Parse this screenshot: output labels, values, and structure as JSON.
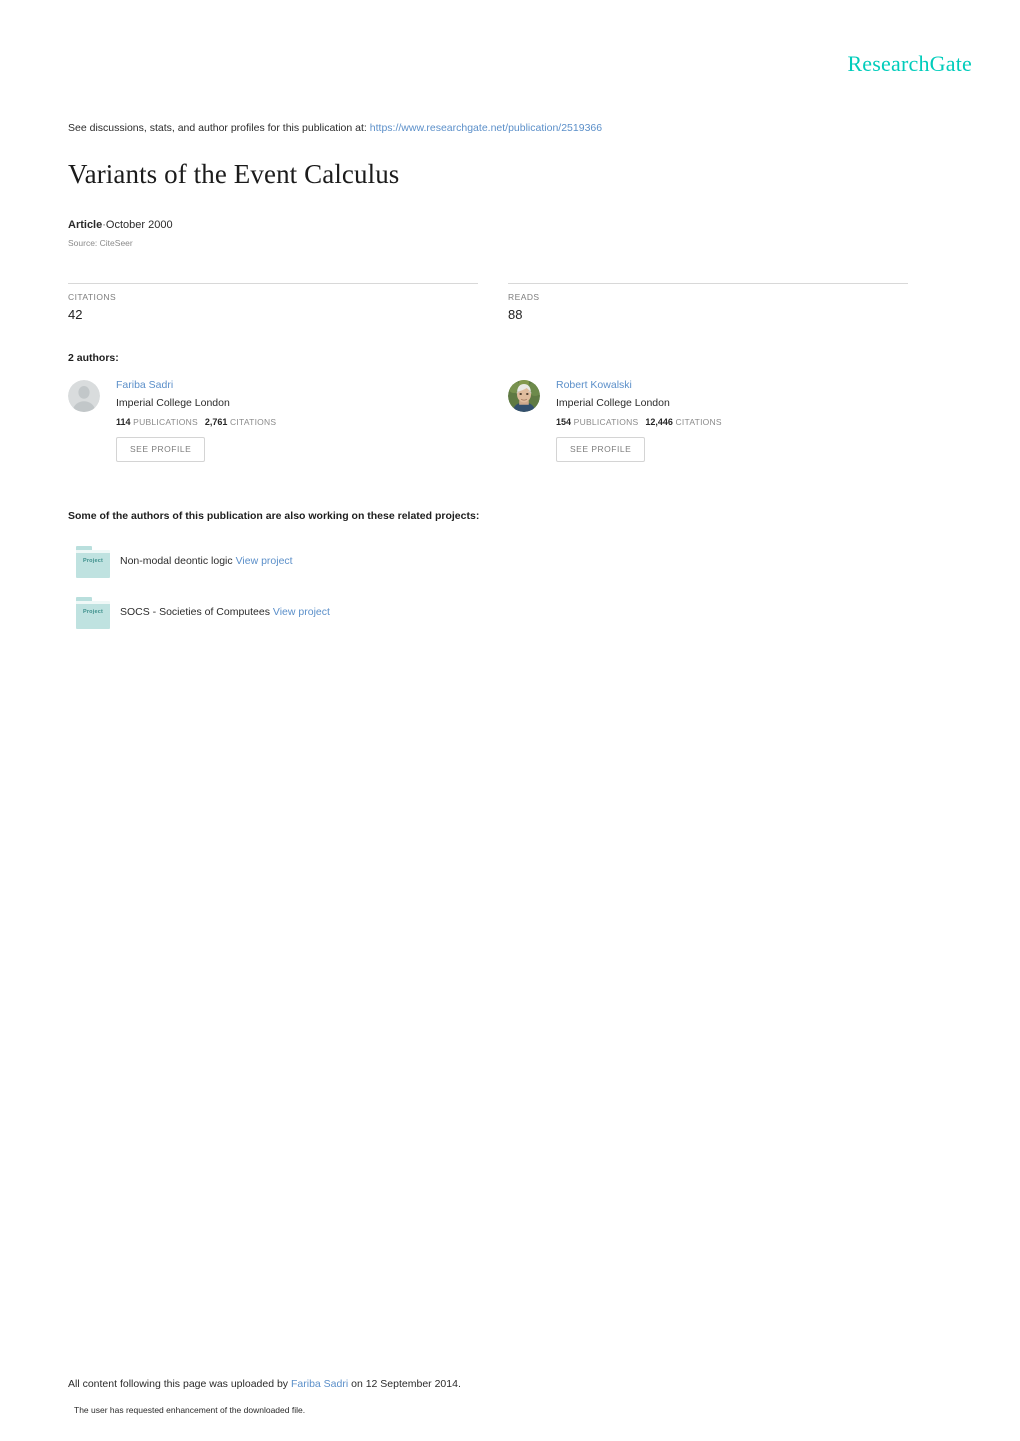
{
  "brand": {
    "name": "ResearchGate",
    "color": "#00ccbb"
  },
  "header": {
    "discussions_prefix": "See discussions, stats, and author profiles for this publication at:",
    "publication_url": "https://www.researchgate.net/publication/2519366"
  },
  "publication": {
    "title": "Variants of the Event Calculus",
    "type": "Article",
    "separator": "·",
    "date": "October 2000",
    "source": "Source: CiteSeer"
  },
  "stats": [
    {
      "label": "CITATIONS",
      "value": "42"
    },
    {
      "label": "READS",
      "value": "88"
    }
  ],
  "authors_section": {
    "heading": "2 authors:",
    "see_profile_label": "SEE PROFILE",
    "authors": [
      {
        "name": "Fariba Sadri",
        "affiliation": "Imperial College London",
        "publications_count": "114",
        "publications_label": "PUBLICATIONS",
        "citations_count": "2,761",
        "citations_label": "CITATIONS",
        "avatar_type": "placeholder-avatar"
      },
      {
        "name": "Robert Kowalski",
        "affiliation": "Imperial College London",
        "publications_count": "154",
        "publications_label": "PUBLICATIONS",
        "citations_count": "12,446",
        "citations_label": "CITATIONS",
        "avatar_type": "photo-avatar"
      }
    ]
  },
  "projects_section": {
    "heading": "Some of the authors of this publication are also working on these related projects:",
    "folder_label": "Project",
    "projects": [
      {
        "title": "Non-modal deontic logic",
        "link_label": "View project"
      },
      {
        "title": "SOCS - Societies of Computees",
        "link_label": "View project"
      }
    ]
  },
  "footer": {
    "upload_prefix": "All content following this page was uploaded by",
    "uploader": "Fariba Sadri",
    "upload_suffix": "on 12 September 2014.",
    "note": "The user has requested enhancement of the downloaded file."
  }
}
